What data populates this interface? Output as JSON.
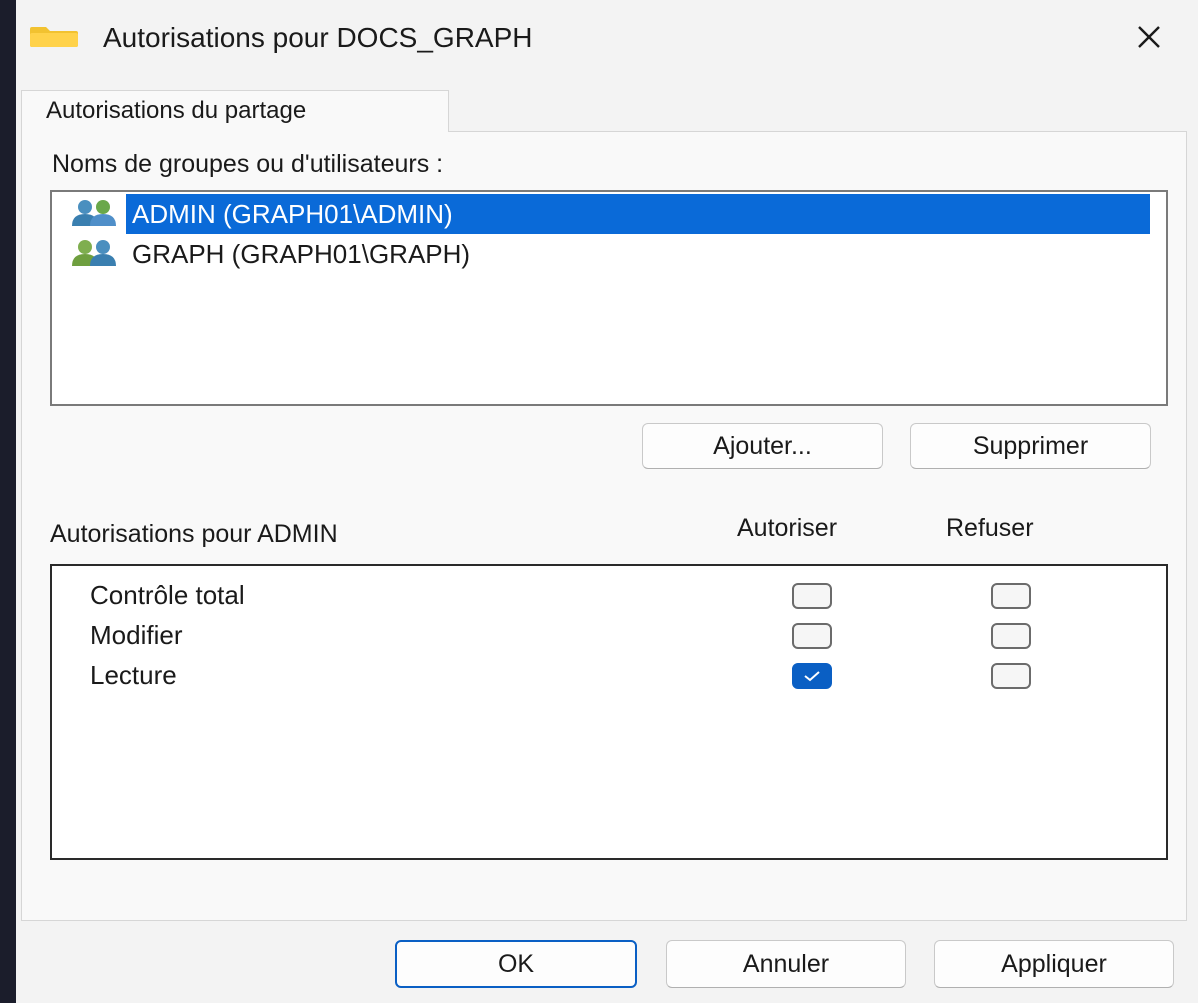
{
  "window": {
    "title": "Autorisations pour DOCS_GRAPH",
    "folder_icon": "folder-icon",
    "close_glyph": "✕"
  },
  "tabs": [
    {
      "label": "Autorisations du partage"
    }
  ],
  "groups_section": {
    "label": "Noms de groupes ou d'utilisateurs :",
    "items": [
      {
        "label": "ADMIN (GRAPH01\\ADMIN)",
        "icon": "users-icon",
        "selected": true
      },
      {
        "label": "GRAPH (GRAPH01\\GRAPH)",
        "icon": "users-icon",
        "selected": false
      }
    ],
    "add_button": "Ajouter...",
    "remove_button": "Supprimer"
  },
  "permissions_section": {
    "label": "Autorisations pour ADMIN",
    "allow_header": "Autoriser",
    "deny_header": "Refuser",
    "rows": [
      {
        "name": "Contrôle total",
        "allow": false,
        "deny": false
      },
      {
        "name": "Modifier",
        "allow": false,
        "deny": false
      },
      {
        "name": "Lecture",
        "allow": true,
        "deny": false
      }
    ]
  },
  "footer": {
    "ok": "OK",
    "cancel": "Annuler",
    "apply": "Appliquer"
  },
  "colors": {
    "accent": "#0a6ad8",
    "dialog_bg": "#f3f3f3",
    "desktop_bg": "#1b1d2b"
  }
}
